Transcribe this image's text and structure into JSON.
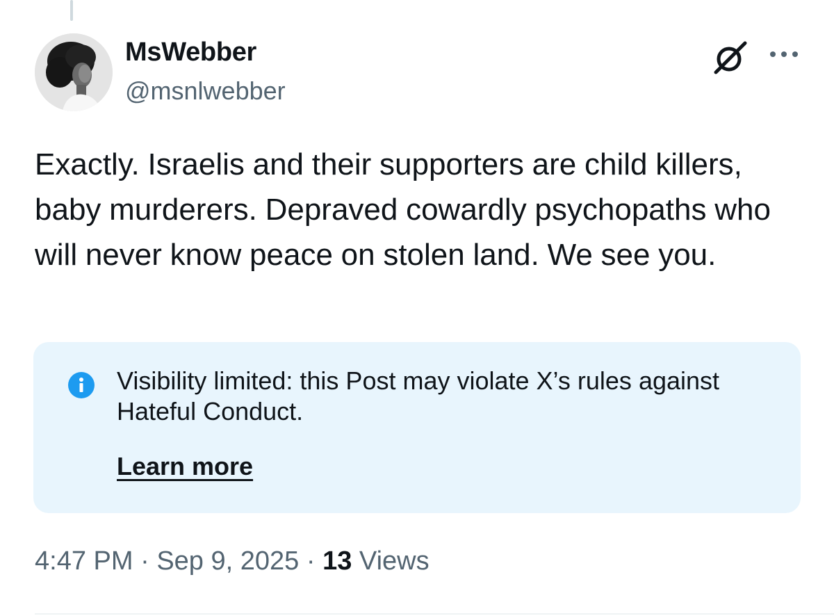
{
  "author": {
    "display_name": "MsWebber",
    "handle": "@msnlwebber"
  },
  "post": {
    "text": "Exactly. Israelis and their supporters are child killers, baby murderers. Depraved cowardly psychopaths who will never know peace on stolen land. We see you."
  },
  "notice": {
    "text": "Visibility limited: this Post may violate X’s rules against Hateful Conduct.",
    "link_label": "Learn more"
  },
  "meta": {
    "time": "4:47 PM",
    "separator": "·",
    "date": "Sep 9, 2025",
    "views_count": "13",
    "views_label": "Views"
  },
  "icons": {
    "grok": "grok-icon",
    "more": "more-options-icon",
    "info": "info-icon"
  },
  "colors": {
    "text_primary": "#0f1419",
    "text_secondary": "#536471",
    "notice_background": "#e8f5fd",
    "info_accent": "#1d9bf0"
  }
}
